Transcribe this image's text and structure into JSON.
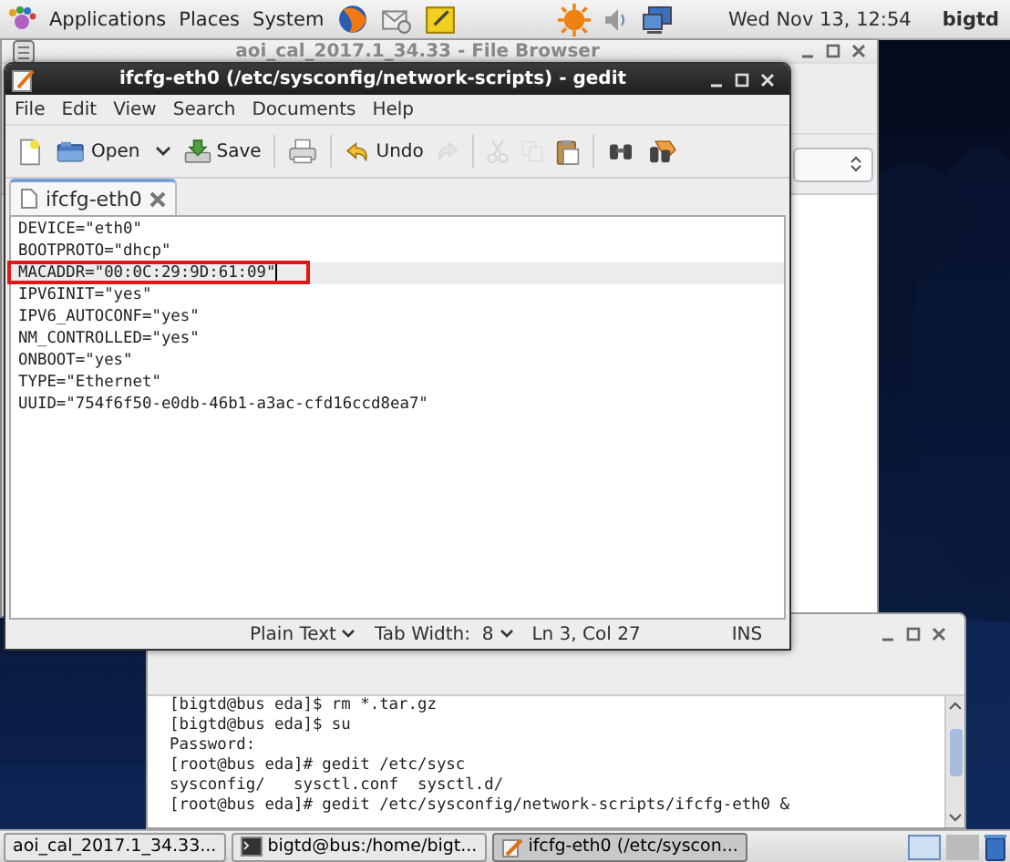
{
  "top_panel": {
    "menus": [
      "Applications",
      "Places",
      "System"
    ],
    "clock": "Wed Nov 13, 12:54",
    "user": "bigtd"
  },
  "file_browser": {
    "title": "aoi_cal_2017.1_34.33 - File Browser"
  },
  "gedit": {
    "title": "ifcfg-eth0 (/etc/sysconfig/network-scripts) - gedit",
    "menu": [
      "File",
      "Edit",
      "View",
      "Search",
      "Documents",
      "Help"
    ],
    "toolbar": [
      {
        "kind": "new",
        "disabled": false
      },
      {
        "kind": "open",
        "label": "Open",
        "disabled": false
      },
      {
        "kind": "save",
        "label": "Save",
        "disabled": false
      },
      {
        "kind": "print",
        "disabled": false
      },
      {
        "kind": "undo",
        "label": "Undo",
        "disabled": false
      },
      {
        "kind": "redo",
        "disabled": true
      },
      {
        "kind": "cut",
        "disabled": true
      },
      {
        "kind": "copy",
        "disabled": true
      },
      {
        "kind": "paste",
        "disabled": false
      },
      {
        "kind": "find",
        "disabled": false
      },
      {
        "kind": "replace",
        "disabled": false
      }
    ],
    "tabs": [
      {
        "label": "ifcfg-eth0",
        "selected": true
      }
    ],
    "lines": [
      {
        "text": "DEVICE=\"eth0\"",
        "current": false,
        "marked": false
      },
      {
        "text": "BOOTPROTO=\"dhcp\"",
        "current": false,
        "marked": false
      },
      {
        "text": "MACADDR=\"00:0C:29:9D:61:09\"",
        "current": true,
        "marked": true
      },
      {
        "text": "IPV6INIT=\"yes\"",
        "current": false,
        "marked": false
      },
      {
        "text": "IPV6_AUTOCONF=\"yes\"",
        "current": false,
        "marked": false
      },
      {
        "text": "NM_CONTROLLED=\"yes\"",
        "current": false,
        "marked": false
      },
      {
        "text": "ONBOOT=\"yes\"",
        "current": false,
        "marked": false
      },
      {
        "text": "TYPE=\"Ethernet\"",
        "current": false,
        "marked": false
      },
      {
        "text": "UUID=\"754f6f50-e0db-46b1-a3ac-cfd16ccd8ea7\"",
        "current": false,
        "marked": false
      }
    ],
    "status_bar": {
      "language": "Plain Text",
      "tab_width": "Tab Width:  8",
      "position": "Ln 3, Col 27",
      "mode": "INS"
    }
  },
  "terminal": {
    "lines": [
      "[bigtd@bus eda]$ rm *.tar.gz",
      "[bigtd@bus eda]$ su",
      "Password:",
      "[root@bus eda]# gedit /etc/sysc",
      "sysconfig/   sysctl.conf  sysctl.d/",
      "[root@bus eda]# gedit /etc/sysconfig/network-scripts/ifcfg-eth0 &"
    ]
  },
  "taskbar": [
    {
      "kind": "folder",
      "label": "aoi_cal_2017.1_34.33...",
      "selected": false
    },
    {
      "kind": "terminal",
      "label": "bigtd@bus:/home/bigt...",
      "selected": false
    },
    {
      "kind": "editor",
      "label": "ifcfg-eth0 (/etc/syscon...",
      "selected": true
    }
  ]
}
